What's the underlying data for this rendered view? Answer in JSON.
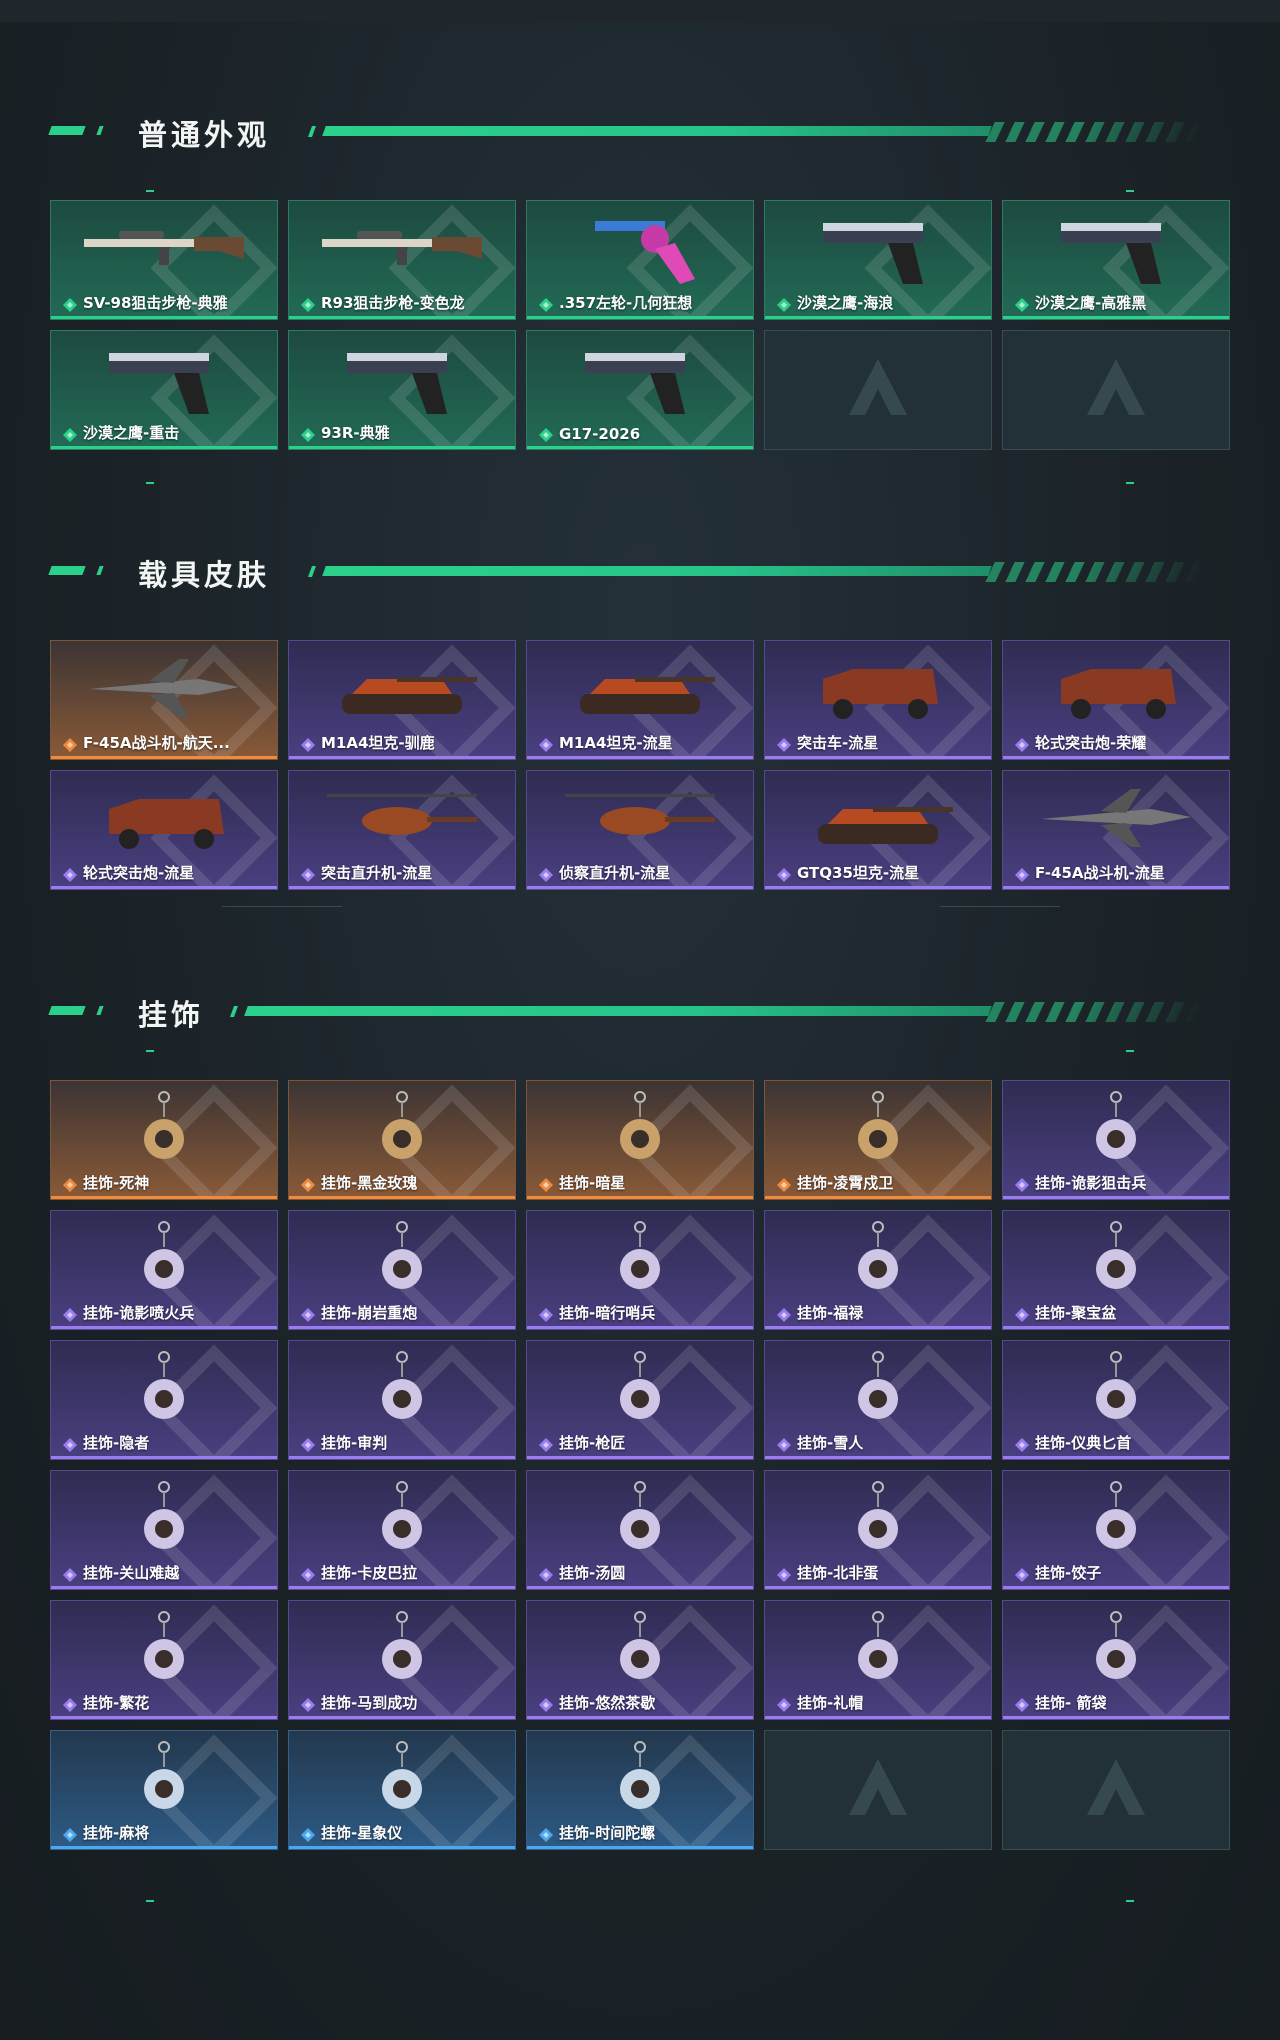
{
  "colors": {
    "accent": "#2bd18a",
    "purple": "#9b7cf0",
    "orange": "#f08a3c",
    "blue": "#4aa8f0"
  },
  "sections": {
    "weapon": {
      "title": "普通外观",
      "items": [
        {
          "label": "SV-98狙击步枪-典雅",
          "rarity": "green",
          "icon": "sniper-rifle-icon"
        },
        {
          "label": "R93狙击步枪-变色龙",
          "rarity": "green",
          "icon": "sniper-rifle-icon"
        },
        {
          "label": ".357左轮-几何狂想",
          "rarity": "green",
          "icon": "revolver-icon"
        },
        {
          "label": "沙漠之鹰-海浪",
          "rarity": "green",
          "icon": "pistol-icon"
        },
        {
          "label": "沙漠之鹰-高雅黑",
          "rarity": "green",
          "icon": "pistol-icon"
        },
        {
          "label": "沙漠之鹰-重击",
          "rarity": "green",
          "icon": "pistol-icon"
        },
        {
          "label": "93R-典雅",
          "rarity": "green",
          "icon": "pistol-icon"
        },
        {
          "label": "G17-2026",
          "rarity": "green",
          "icon": "pistol-icon"
        },
        {
          "label": "",
          "rarity": "empty",
          "icon": "placeholder-logo-icon"
        },
        {
          "label": "",
          "rarity": "empty",
          "icon": "placeholder-logo-icon"
        }
      ]
    },
    "vehicle": {
      "title": "载具皮肤",
      "items": [
        {
          "label": "F-45A战斗机-航天...",
          "rarity": "orange",
          "icon": "jet-icon"
        },
        {
          "label": "M1A4坦克-驯鹿",
          "rarity": "purple",
          "icon": "tank-icon"
        },
        {
          "label": "M1A4坦克-流星",
          "rarity": "purple",
          "icon": "tank-icon"
        },
        {
          "label": "突击车-流星",
          "rarity": "purple",
          "icon": "armored-car-icon"
        },
        {
          "label": "轮式突击炮-荣耀",
          "rarity": "purple",
          "icon": "armored-car-icon"
        },
        {
          "label": "轮式突击炮-流星",
          "rarity": "purple",
          "icon": "armored-car-icon"
        },
        {
          "label": "突击直升机-流星",
          "rarity": "purple",
          "icon": "helicopter-icon"
        },
        {
          "label": "侦察直升机-流星",
          "rarity": "purple",
          "icon": "helicopter-icon"
        },
        {
          "label": "GTQ35坦克-流星",
          "rarity": "purple",
          "icon": "tank-icon"
        },
        {
          "label": "F-45A战斗机-流星",
          "rarity": "purple",
          "icon": "jet-icon"
        }
      ]
    },
    "charm": {
      "title": "挂饰",
      "items": [
        {
          "label": "挂饰-死神",
          "rarity": "orange",
          "icon": "charm-icon"
        },
        {
          "label": "挂饰-黑金玫瑰",
          "rarity": "orange",
          "icon": "charm-icon"
        },
        {
          "label": "挂饰-暗星",
          "rarity": "orange",
          "icon": "charm-icon"
        },
        {
          "label": "挂饰-凌霄戍卫",
          "rarity": "orange",
          "icon": "charm-icon"
        },
        {
          "label": "挂饰-诡影狙击兵",
          "rarity": "purple",
          "icon": "charm-icon"
        },
        {
          "label": "挂饰-诡影喷火兵",
          "rarity": "purple",
          "icon": "charm-icon"
        },
        {
          "label": "挂饰-崩岩重炮",
          "rarity": "purple",
          "icon": "charm-icon"
        },
        {
          "label": "挂饰-暗行哨兵",
          "rarity": "purple",
          "icon": "charm-icon"
        },
        {
          "label": "挂饰-福禄",
          "rarity": "purple",
          "icon": "charm-icon"
        },
        {
          "label": "挂饰-聚宝盆",
          "rarity": "purple",
          "icon": "charm-icon"
        },
        {
          "label": "挂饰-隐者",
          "rarity": "purple",
          "icon": "charm-icon"
        },
        {
          "label": "挂饰-审判",
          "rarity": "purple",
          "icon": "charm-icon"
        },
        {
          "label": "挂饰-枪匠",
          "rarity": "purple",
          "icon": "charm-icon"
        },
        {
          "label": "挂饰-雪人",
          "rarity": "purple",
          "icon": "charm-icon"
        },
        {
          "label": "挂饰-仪典匕首",
          "rarity": "purple",
          "icon": "charm-icon"
        },
        {
          "label": "挂饰-关山难越",
          "rarity": "purple",
          "icon": "charm-icon"
        },
        {
          "label": "挂饰-卡皮巴拉",
          "rarity": "purple",
          "icon": "charm-icon"
        },
        {
          "label": "挂饰-汤圆",
          "rarity": "purple",
          "icon": "charm-icon"
        },
        {
          "label": "挂饰-北非蛋",
          "rarity": "purple",
          "icon": "charm-icon"
        },
        {
          "label": "挂饰-饺子",
          "rarity": "purple",
          "icon": "charm-icon"
        },
        {
          "label": "挂饰-繁花",
          "rarity": "purple",
          "icon": "charm-icon"
        },
        {
          "label": "挂饰-马到成功",
          "rarity": "purple",
          "icon": "charm-icon"
        },
        {
          "label": "挂饰-悠然茶歇",
          "rarity": "purple",
          "icon": "charm-icon"
        },
        {
          "label": "挂饰-礼帽",
          "rarity": "purple",
          "icon": "charm-icon"
        },
        {
          "label": "挂饰- 箭袋",
          "rarity": "purple",
          "icon": "charm-icon"
        },
        {
          "label": "挂饰-麻将",
          "rarity": "blue",
          "icon": "charm-icon"
        },
        {
          "label": "挂饰-星象仪",
          "rarity": "blue",
          "icon": "charm-icon"
        },
        {
          "label": "挂饰-时间陀螺",
          "rarity": "blue",
          "icon": "charm-icon"
        },
        {
          "label": "",
          "rarity": "empty",
          "icon": "placeholder-logo-icon"
        },
        {
          "label": "",
          "rarity": "empty",
          "icon": "placeholder-logo-icon"
        }
      ]
    }
  }
}
